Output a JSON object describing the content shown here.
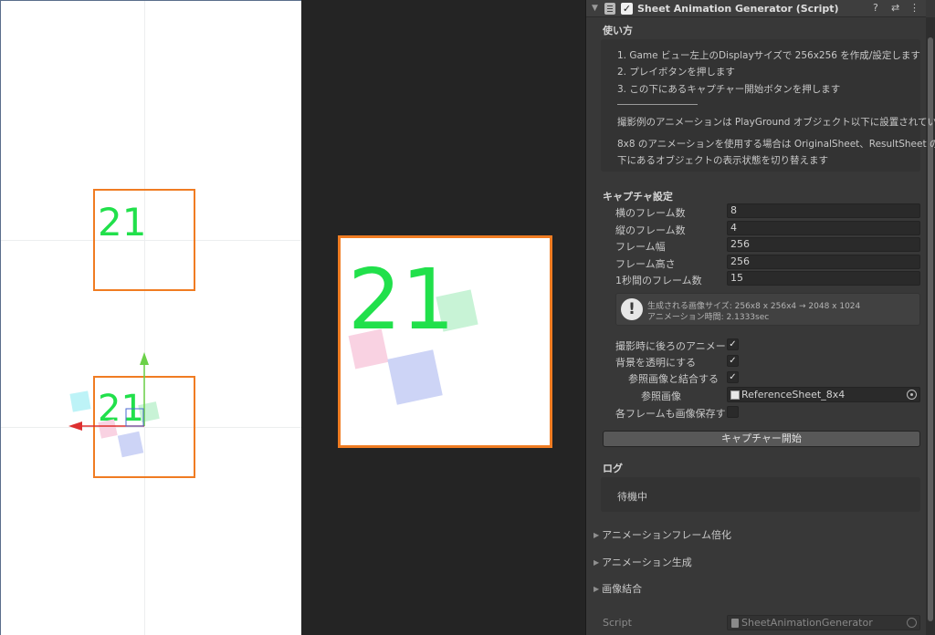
{
  "scene": {
    "top_frame_number": "21",
    "bottom_frame_number": "21"
  },
  "game": {
    "frame_number": "21"
  },
  "inspector": {
    "component_title": "Sheet Animation Generator (Script)",
    "enabled": true,
    "usage": {
      "label": "使い方",
      "lines": [
        "1. Game ビュー左上のDisplayサイズで 256x256 を作成/設定します",
        "2. プレイボタンを押します",
        "3. この下にあるキャプチャー開始ボタンを押します",
        "撮影例のアニメーションは PlayGround オブジェクト以下に設置されています",
        "8x8 のアニメーションを使用する場合は OriginalSheet、ResultSheet の",
        "下にあるオブジェクトの表示状態を切り替えます"
      ]
    },
    "capture": {
      "label": "キャプチャ設定",
      "fields": [
        {
          "label": "横のフレーム数",
          "value": "8"
        },
        {
          "label": "縦のフレーム数",
          "value": "4"
        },
        {
          "label": "フレーム幅",
          "value": "256"
        },
        {
          "label": "フレーム高さ",
          "value": "256"
        },
        {
          "label": "1秒間のフレーム数",
          "value": "15"
        }
      ],
      "info_line1": "生成される画像サイズ: 256x8 x 256x4 → 2048 x 1024",
      "info_line2": "アニメーション時間: 2.1333sec",
      "toggles": [
        {
          "label": "撮影時に後ろのアニメーションを止める",
          "checked": true
        },
        {
          "label": "背景を透明にする",
          "checked": true
        },
        {
          "label": "参照画像と結合する",
          "checked": true
        }
      ],
      "ref_image_label": "参照画像",
      "ref_image_value": "ReferenceSheet_8x4",
      "save_each_label": "各フレームも画像保存する (",
      "save_each_checked": false,
      "start_button": "キャプチャー開始"
    },
    "log": {
      "label": "ログ",
      "text": "待機中"
    },
    "foldouts": [
      "アニメーションフレーム倍化",
      "アニメーション生成",
      "画像結合"
    ],
    "script": {
      "label": "Script",
      "value": "SheetAnimationGenerator"
    }
  }
}
